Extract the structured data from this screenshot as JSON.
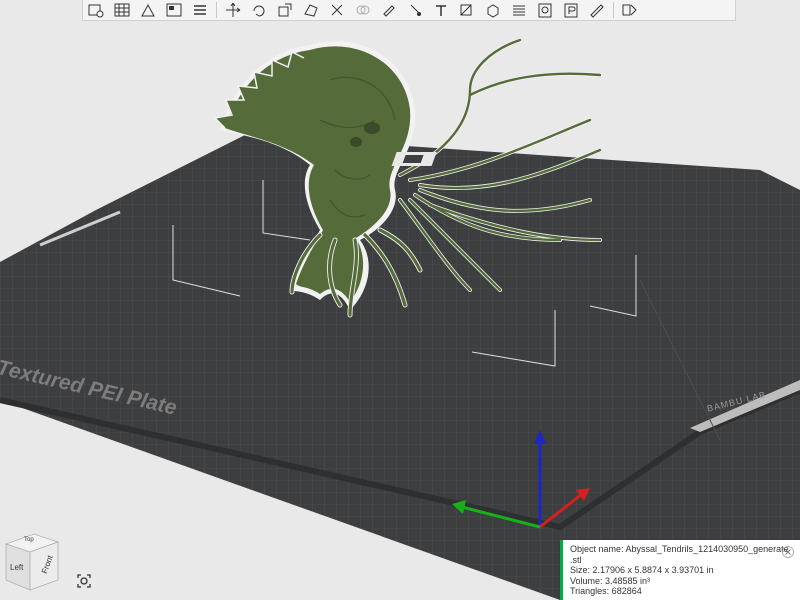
{
  "toolbar": {
    "buttons": [
      {
        "icon": "add-plate-icon"
      },
      {
        "icon": "grid-arrange-icon"
      },
      {
        "icon": "orient-icon"
      },
      {
        "icon": "plate-layout-icon"
      },
      {
        "icon": "menu-lines-icon"
      },
      {
        "separator": true
      },
      {
        "icon": "move-icon"
      },
      {
        "icon": "rotate-icon"
      },
      {
        "icon": "scale-icon"
      },
      {
        "icon": "lay-on-face-icon"
      },
      {
        "icon": "cut-icon"
      },
      {
        "icon": "mesh-boolean-icon"
      },
      {
        "icon": "paint-support-icon"
      },
      {
        "icon": "seam-paint-icon"
      },
      {
        "icon": "text-icon"
      },
      {
        "icon": "measure-icon"
      },
      {
        "icon": "assembly-icon"
      },
      {
        "icon": "variable-layer-icon"
      },
      {
        "icon": "object-o-icon"
      },
      {
        "icon": "plate-p-icon"
      },
      {
        "icon": "ruler-icon"
      },
      {
        "separator": true
      },
      {
        "icon": "split-icon"
      }
    ]
  },
  "bed": {
    "label": "Textured PEI Plate",
    "brand": "BAMBU LAB"
  },
  "view_cube": {
    "top": "Top",
    "left": "Left",
    "front": "Front"
  },
  "object_info": {
    "name_line1": "Object name: Abyssal_Tendrils_1214030950_generate",
    "name_line2": ".stl",
    "size": "Size: 2.17906 x 5.8874 x 3.93701 in",
    "volume": "Volume: 3.48585 in³",
    "triangles": "Triangles: 682864"
  },
  "colors": {
    "accent": "#00ae42",
    "model": "#556b3a",
    "bed": "#3d3e40",
    "background": "#e9e9ea",
    "axis_x": "#d62020",
    "axis_y": "#18b018",
    "axis_z": "#1e26c8"
  }
}
